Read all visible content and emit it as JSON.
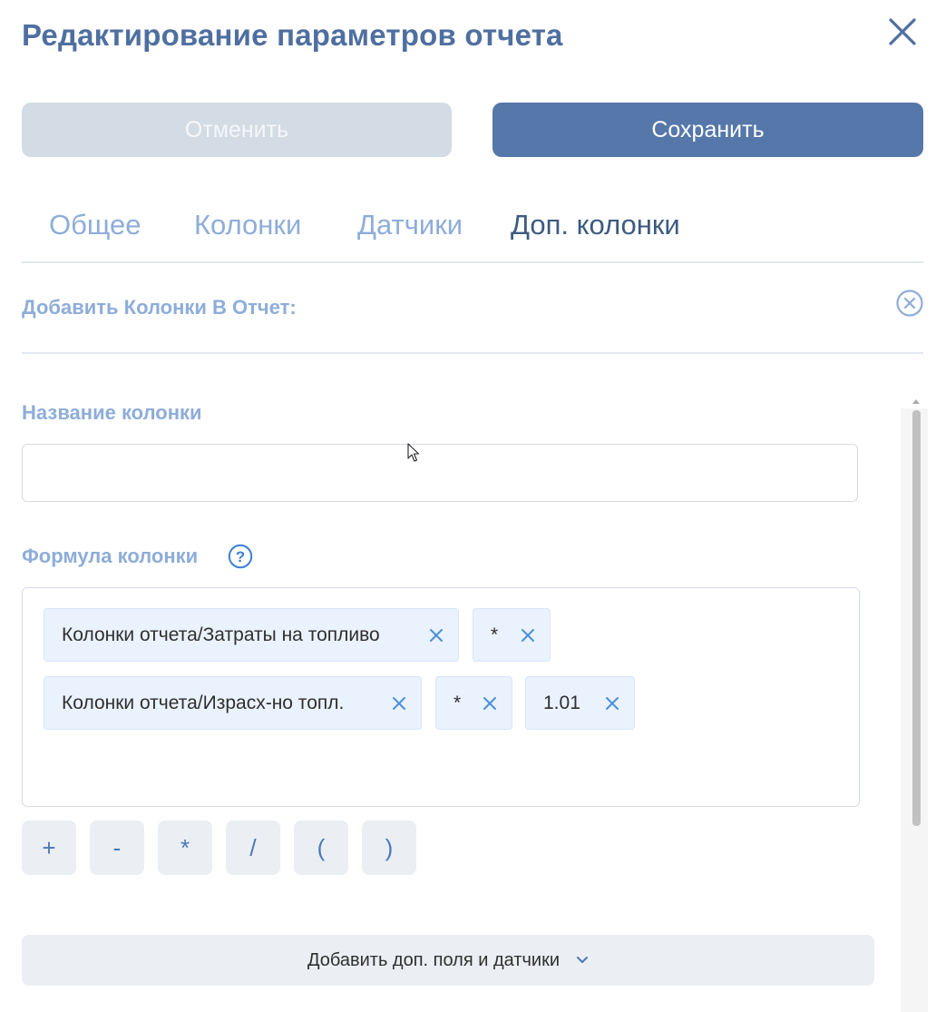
{
  "dialog": {
    "title": "Редактирование параметров отчета",
    "cancel_label": "Отменить",
    "save_label": "Сохранить",
    "close_icon": "close-icon"
  },
  "tabs": [
    {
      "label": "Общее",
      "active": false
    },
    {
      "label": "Колонки",
      "active": false
    },
    {
      "label": "Датчики",
      "active": false
    },
    {
      "label": "Доп. колонки",
      "active": true
    }
  ],
  "section": {
    "title": "Добавить Колонки В Отчет:",
    "remove_icon": "circle-close-icon"
  },
  "column_name": {
    "label": "Название колонки",
    "value": "",
    "placeholder": ""
  },
  "formula": {
    "label": "Формула колонки",
    "help_icon": "question-circle-icon",
    "rows": [
      [
        {
          "text": "Колонки отчета/Затраты на топливо"
        },
        {
          "text": "*"
        }
      ],
      [
        {
          "text": "Колонки отчета/Израсх-но топл."
        },
        {
          "text": "*"
        },
        {
          "text": "1.01"
        }
      ]
    ],
    "operators": [
      "+",
      "-",
      "*",
      "/",
      "(",
      ")"
    ]
  },
  "add_extra": {
    "label": "Добавить доп. поля и датчики",
    "icon": "chevron-down-icon"
  },
  "colors": {
    "title": "#4f6fa0",
    "accent": "#5577aa",
    "tab_inactive": "#8eadd9",
    "tab_active": "#3d5a80",
    "chip_bg": "#eaf2fd",
    "chip_close": "#4a90d9"
  }
}
